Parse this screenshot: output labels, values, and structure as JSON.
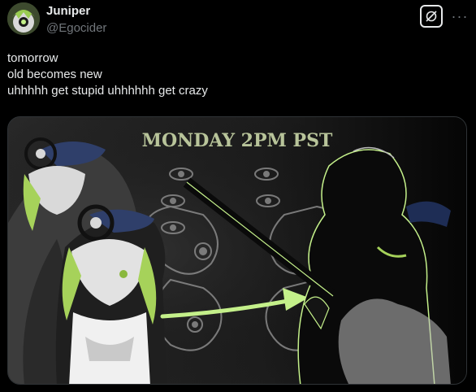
{
  "post": {
    "author": {
      "display_name": "Juniper",
      "handle": "@Egocider"
    },
    "text_lines": [
      "tomorrow",
      "old becomes new",
      "uhhhhh get stupid uhhhhhh get crazy"
    ],
    "actions": {
      "grok_icon": "grok-icon",
      "more_icon": "more-options-icon",
      "more_glyph": "···"
    },
    "media": {
      "headline": "MONDAY 2PM PST"
    }
  },
  "colors": {
    "background": "#000000",
    "text": "#e7e9ea",
    "muted": "#71767b",
    "accent_green": "#c4f08a",
    "headline_color": "#b8c49a"
  }
}
